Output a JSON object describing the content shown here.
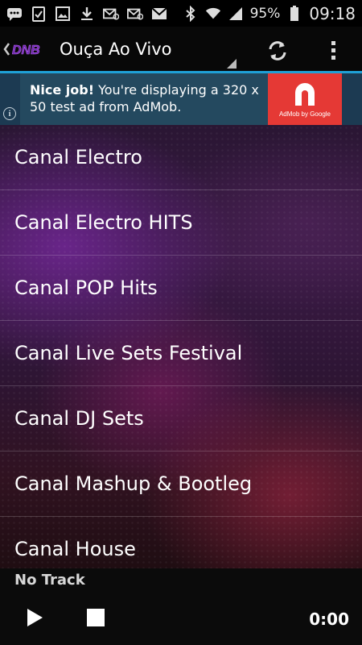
{
  "status_bar": {
    "battery": "95%",
    "time": "09:18",
    "icons": [
      "chat-icon",
      "clipboard-check-icon",
      "image-icon",
      "download-icon",
      "email-icon",
      "email-icon",
      "gmail-icon",
      "bluetooth-icon",
      "wifi-icon",
      "signal-icon",
      "battery-icon"
    ]
  },
  "action_bar": {
    "title": "Ouça Ao Vivo",
    "logo_text": "DNB"
  },
  "ad": {
    "bold": "Nice job!",
    "text": " You're displaying a 320 x 50 test ad from AdMob.",
    "logo_caption": "AdMob by Google"
  },
  "channels": [
    "Canal Electro",
    "Canal Electro HITS",
    "Canal POP Hits",
    "Canal Live Sets Festival",
    "Canal DJ Sets",
    "Canal Mashup & Bootleg",
    "Canal House"
  ],
  "player": {
    "track": "No Track",
    "time": "0:00"
  },
  "colors": {
    "accent": "#1fa0d6",
    "ad_bg": "#24495f",
    "admob_red": "#e53935"
  }
}
